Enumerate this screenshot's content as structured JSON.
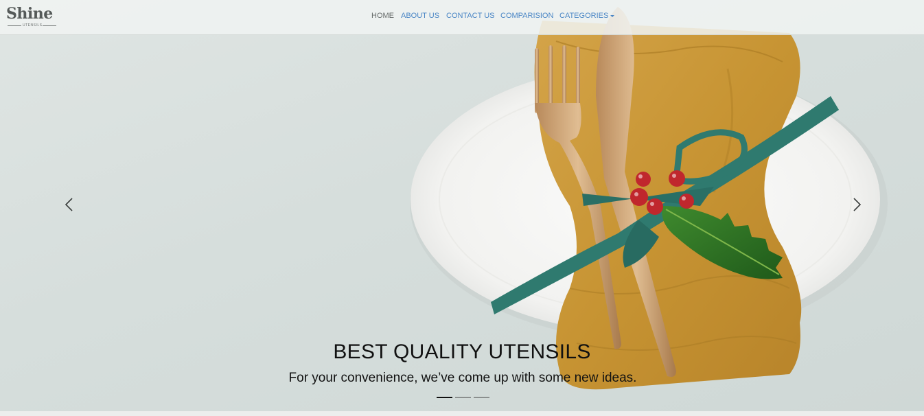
{
  "brand": {
    "name": "Shine",
    "tagline": "UTENSILS"
  },
  "nav": {
    "items": [
      {
        "label": "HOME",
        "active": true
      },
      {
        "label": "ABOUT US",
        "active": false
      },
      {
        "label": "CONTACT US",
        "active": false
      },
      {
        "label": "COMPARISION",
        "active": false
      },
      {
        "label": "CATEGORIES",
        "active": false,
        "dropdown": true
      }
    ]
  },
  "carousel": {
    "caption_title": "BEST QUALITY UTENSILS",
    "caption_text": "For your convenience, we’ve come up with some new ideas.",
    "slide_count": 3,
    "active_slide": 1,
    "prev_icon": "chevron-left-icon",
    "next_icon": "chevron-right-icon"
  },
  "colors": {
    "nav_link": "#4a86c5",
    "nav_active": "#666b6a",
    "caption": "#111111",
    "napkin": "#c99a3a",
    "ribbon": "#2f7a6f",
    "berries": "#c0272d"
  }
}
